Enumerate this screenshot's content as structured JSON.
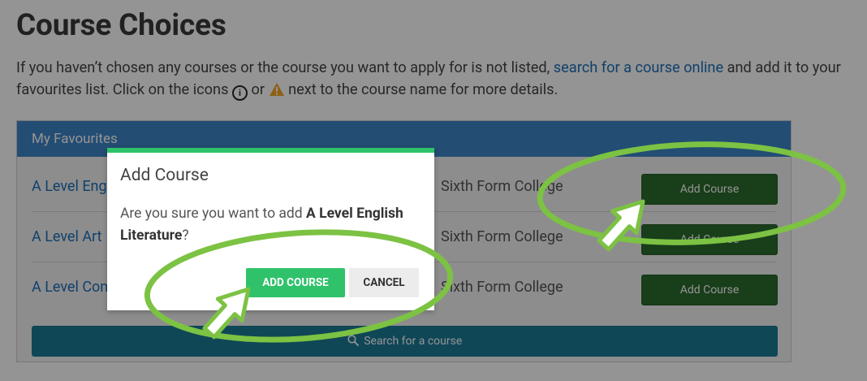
{
  "page": {
    "title": "Course Choices",
    "intro": {
      "text_before_link": "If you haven’t chosen any courses or the course you want to apply for is not listed,",
      "link_text": "search for a course online",
      "text_after_link": "and add it to your favourites list. Click on the icons",
      "text_or": "or",
      "text_end": "next to the course name for more details."
    }
  },
  "favourites": {
    "header": "My Favourites",
    "rows": [
      {
        "course": "A Level English Literature",
        "college": "Sixth Form College",
        "button": "Add Course"
      },
      {
        "course": "A Level Art",
        "college": "Sixth Form College",
        "button": "Add Course"
      },
      {
        "course": "A Level Computing",
        "college": "Sixth Form College",
        "button": "Add Course"
      }
    ],
    "search_button": "Search for a course"
  },
  "modal": {
    "title": "Add Course",
    "question_prefix": "Are you sure you want to add",
    "question_course": "A Level English Literature",
    "question_suffix": "?",
    "confirm_label": "ADD COURSE",
    "cancel_label": "CANCEL"
  },
  "icons": {
    "info": "info-icon",
    "warning": "warning-icon",
    "search": "search-icon",
    "pointer": "pointer-arrow-icon"
  },
  "colors": {
    "link": "#1d6fb8",
    "panel_header": "#3e86c8",
    "add_button": "#2c6b2d",
    "search_button": "#1a7a97",
    "modal_accent": "#2fc26a",
    "annotation": "#7cc243",
    "warning": "#f5a623"
  }
}
